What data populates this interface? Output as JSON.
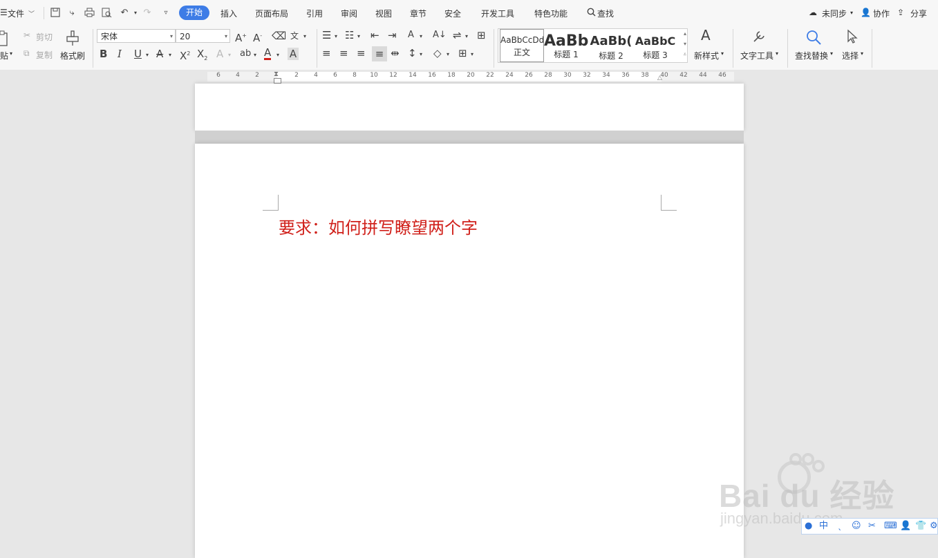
{
  "menubar": {
    "file": "文件",
    "tabs": [
      "开始",
      "插入",
      "页面布局",
      "引用",
      "审阅",
      "视图",
      "章节",
      "安全",
      "开发工具",
      "特色功能"
    ],
    "active_tab": "开始",
    "search": "查找",
    "sync": "未同步",
    "collab": "协作",
    "share": "分享"
  },
  "ribbon": {
    "paste": "贴",
    "cut": "剪切",
    "copy": "复制",
    "format_painter": "格式刷",
    "font_name": "宋体",
    "font_size": "20",
    "styles": [
      {
        "preview": "AaBbCcDd",
        "label": "正文"
      },
      {
        "preview": "AaBb",
        "label": "标题 1"
      },
      {
        "preview": "AaBb(",
        "label": "标题 2"
      },
      {
        "preview": "AaBbC",
        "label": "标题 3"
      }
    ],
    "new_style": "新样式",
    "text_tools": "文字工具",
    "find_replace": "查找替换",
    "select": "选择"
  },
  "ruler": {
    "ticks": [
      "6",
      "4",
      "2",
      "2",
      "4",
      "6",
      "8",
      "10",
      "12",
      "14",
      "16",
      "18",
      "20",
      "22",
      "24",
      "26",
      "28",
      "30",
      "32",
      "34",
      "36",
      "38",
      "40",
      "42",
      "44",
      "46"
    ]
  },
  "document": {
    "text": "要求：如何拼写瞭望两个字"
  },
  "watermark": {
    "logo": "Bai du 经验",
    "url": "jingyan.baidu.com"
  },
  "colors": {
    "accent": "#3d7ce6",
    "doc_text": "#d0201a",
    "font_color_bar": "#d0201a"
  }
}
